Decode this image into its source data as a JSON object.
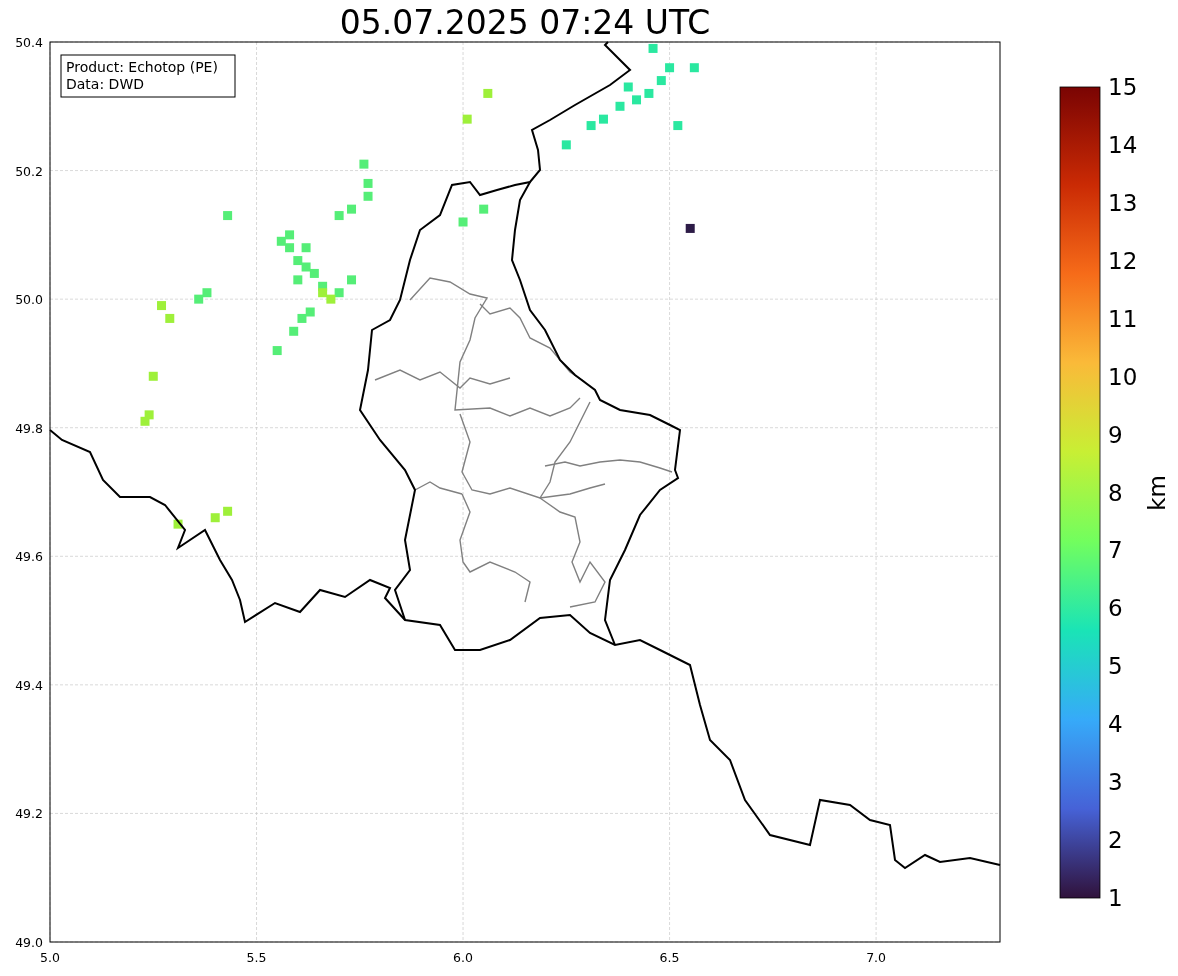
{
  "title": "05.07.2025 07:24 UTC",
  "info_box": [
    "Product: Echotop (PE)",
    "Data: DWD"
  ],
  "chart_data": {
    "type": "scatter",
    "grid": true,
    "xlim": [
      5.0,
      7.3
    ],
    "ylim": [
      49.0,
      50.4
    ],
    "xticks": [
      {
        "value": 5.0,
        "label": "5.0"
      },
      {
        "value": 5.5,
        "label": "5.5"
      },
      {
        "value": 6.0,
        "label": "6.0"
      },
      {
        "value": 6.5,
        "label": "6.5"
      },
      {
        "value": 7.0,
        "label": "7.0"
      }
    ],
    "yticks": [
      {
        "value": 49.0,
        "label": "49.0"
      },
      {
        "value": 49.2,
        "label": "49.2"
      },
      {
        "value": 49.4,
        "label": "49.4"
      },
      {
        "value": 49.6,
        "label": "49.6"
      },
      {
        "value": 49.8,
        "label": "49.8"
      },
      {
        "value": 50.0,
        "label": "50.0"
      },
      {
        "value": 50.2,
        "label": "50.2"
      },
      {
        "value": 50.4,
        "label": "50.4"
      }
    ],
    "series": [
      {
        "color": "#55ee77",
        "x": [
          5.58,
          5.6,
          5.62,
          5.58,
          5.56,
          5.62,
          5.64,
          5.6,
          5.66,
          5.63,
          5.61,
          5.59,
          5.55,
          5.76,
          5.77,
          5.77,
          5.73,
          5.7,
          6.05,
          6.0,
          5.38,
          5.36,
          5.43,
          5.73,
          5.7
        ],
        "values": [
          50.08,
          50.06,
          50.05,
          50.1,
          50.09,
          50.08,
          50.04,
          50.03,
          50.02,
          49.98,
          49.97,
          49.95,
          49.92,
          50.21,
          50.18,
          50.16,
          50.14,
          50.13,
          50.14,
          50.12,
          50.01,
          50.0,
          50.13,
          50.03,
          50.01
        ]
      },
      {
        "color": "#9ef03a",
        "x": [
          5.66,
          5.68,
          5.24,
          5.23,
          5.25,
          5.4,
          5.43,
          5.31,
          5.27,
          5.29,
          6.01,
          6.06
        ],
        "values": [
          50.01,
          50.0,
          49.82,
          49.81,
          49.88,
          49.66,
          49.67,
          49.65,
          49.99,
          49.97,
          50.28,
          50.32
        ]
      },
      {
        "color": "#2ae8a0",
        "x": [
          6.5,
          6.48,
          6.45,
          6.42,
          6.38,
          6.34,
          6.31,
          6.25,
          6.46,
          6.52,
          6.56,
          6.4
        ],
        "values": [
          50.36,
          50.34,
          50.32,
          50.31,
          50.3,
          50.28,
          50.27,
          50.24,
          50.39,
          50.27,
          50.36,
          50.33
        ]
      },
      {
        "color": "#2d1b47",
        "x": [
          6.55
        ],
        "values": [
          50.11
        ]
      }
    ]
  },
  "colorbar": {
    "label": "km",
    "ticks": [
      "15",
      "14",
      "13",
      "12",
      "11",
      "10",
      "9",
      "8",
      "7",
      "6",
      "5",
      "4",
      "3",
      "2",
      "1"
    ]
  }
}
